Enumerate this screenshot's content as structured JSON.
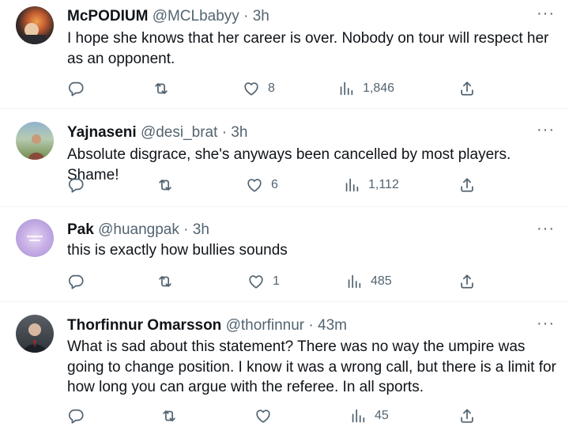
{
  "tweets": [
    {
      "name": "McPODIUM",
      "handle": "@MCLbabyy",
      "sep": "·",
      "time": "3h",
      "text": "I hope she knows that her career is over. Nobody on tour will respect her as an opponent.",
      "replies": "",
      "retweets": "",
      "likes": "8",
      "views": "1,846"
    },
    {
      "name": "Yajnaseni",
      "handle": "@desi_brat",
      "sep": "·",
      "time": "3h",
      "text": "Absolute disgrace, she's anyways been cancelled by most players. Shame!",
      "replies": "",
      "retweets": "",
      "likes": "6",
      "views": "1,112"
    },
    {
      "name": "Pak",
      "handle": "@huangpak",
      "sep": "·",
      "time": "3h",
      "text": "this is exactly how bullies sounds",
      "replies": "",
      "retweets": "",
      "likes": "1",
      "views": "485"
    },
    {
      "name": "Thorfinnur Omarsson",
      "handle": "@thorfinnur",
      "sep": "·",
      "time": "43m",
      "text": "What is sad about this statement? There was no way the umpire was going to change position. I know it was a wrong call, but there is a limit for how long you can argue with the referee. In all sports.",
      "replies": "",
      "retweets": "",
      "likes": "",
      "views": "45"
    }
  ],
  "icons": {
    "more": "more-horizontal-icon",
    "reply": "reply-icon",
    "retweet": "retweet-icon",
    "like": "heart-icon",
    "views": "views-icon",
    "share": "share-icon"
  },
  "colors": {
    "text": "#0f1419",
    "secondary": "#536471",
    "divider": "#eff3f4"
  }
}
